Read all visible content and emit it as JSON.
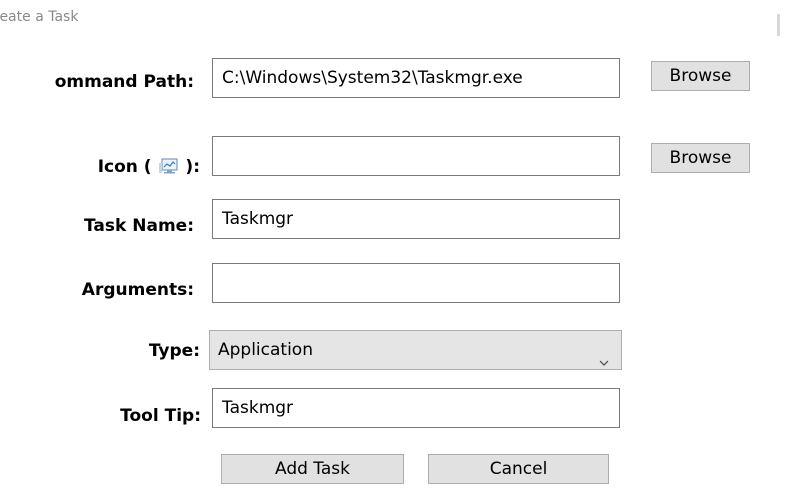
{
  "window": {
    "title": "reate a Task"
  },
  "form": {
    "command_path": {
      "label": "ommand Path:",
      "value": "C:\\Windows\\System32\\Taskmgr.exe"
    },
    "icon": {
      "label_prefix": "Icon (",
      "label_suffix": "):",
      "value": "",
      "icon_name": "monitor-chart-icon"
    },
    "task_name": {
      "label": "Task Name:",
      "value": "Taskmgr"
    },
    "arguments": {
      "label": "Arguments:",
      "value": ""
    },
    "type": {
      "label": "Type:",
      "selected": "Application"
    },
    "tool_tip": {
      "label": "Tool Tip:",
      "value": "Taskmgr"
    }
  },
  "buttons": {
    "browse_command": "Browse",
    "browse_icon": "Browse",
    "add_task": "Add Task",
    "cancel": "Cancel"
  },
  "colors": {
    "title_text": "#8a8a8a",
    "button_bg": "#e1e1e1",
    "select_bg": "#e5e5e5",
    "field_border": "#7a7a7a"
  }
}
